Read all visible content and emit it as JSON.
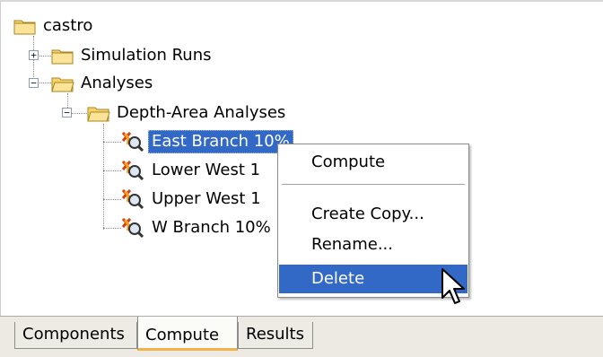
{
  "tree": {
    "root": {
      "label": "castro",
      "icon": "folder-icon"
    },
    "simulation_runs": {
      "label": "Simulation Runs",
      "expander": "+"
    },
    "analyses": {
      "label": "Analyses",
      "expander": "−"
    },
    "depth_area": {
      "label": "Depth-Area Analyses",
      "expander": "−"
    },
    "items": [
      {
        "label": "East Branch 10%",
        "selected": true
      },
      {
        "label": "Lower West 1"
      },
      {
        "label": "Upper West 1"
      },
      {
        "label": "W Branch 10%"
      }
    ]
  },
  "context_menu": {
    "compute": "Compute",
    "create_copy": "Create Copy...",
    "rename": "Rename...",
    "delete": "Delete",
    "highlight_color": "#3369c6"
  },
  "tabs": [
    {
      "label": "Components"
    },
    {
      "label": "Compute",
      "active": true
    },
    {
      "label": "Results"
    }
  ]
}
